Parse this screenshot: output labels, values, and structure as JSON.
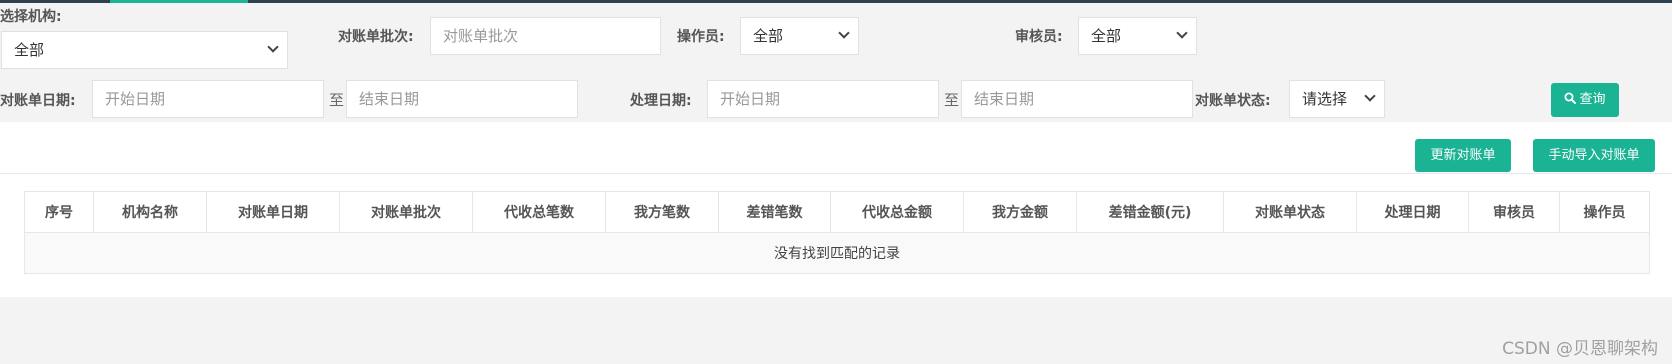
{
  "filters": {
    "org_label": "选择机构:",
    "org_value": "全部",
    "batch_label": "对账单批次:",
    "batch_placeholder": "对账单批次",
    "operator_label": "操作员:",
    "operator_value": "全部",
    "auditor_label": "审核员:",
    "auditor_value": "全部",
    "statement_date_label": "对账单日期:",
    "statement_start_placeholder": "开始日期",
    "statement_to": "至",
    "statement_end_placeholder": "结束日期",
    "process_date_label": "处理日期:",
    "process_start_placeholder": "开始日期",
    "process_to": "至",
    "process_end_placeholder": "结束日期",
    "status_label": "对账单状态:",
    "status_value": "请选择",
    "query_button": "查询"
  },
  "toolbar": {
    "update_button": "更新对账单",
    "import_button": "手动导入对账单"
  },
  "table": {
    "columns": [
      "序号",
      "机构名称",
      "对账单日期",
      "对账单批次",
      "代收总笔数",
      "我方笔数",
      "差错笔数",
      "代收总金额",
      "我方金额",
      "差错金额(元)",
      "对账单状态",
      "处理日期",
      "审核员",
      "操作员"
    ],
    "empty_message": "没有找到匹配的记录"
  },
  "watermark": "CSDN @贝恩聊架构",
  "colors": {
    "accent": "#1ab394",
    "top_bar": "#2f4050"
  }
}
